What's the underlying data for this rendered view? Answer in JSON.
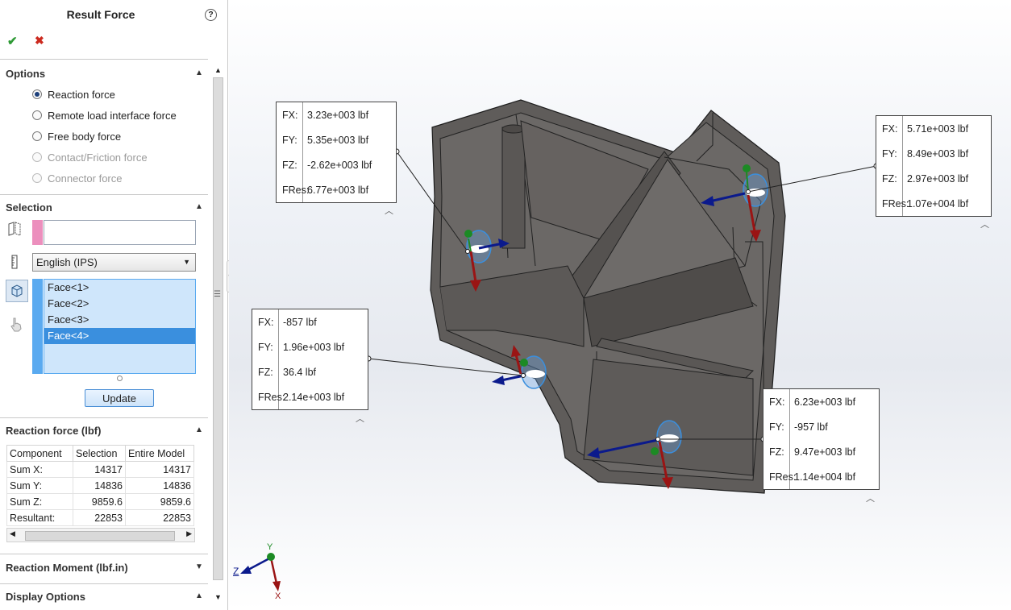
{
  "panel": {
    "title": "Result Force",
    "help": "?",
    "ok": "✔",
    "cancel": "✖",
    "options": {
      "header": "Options",
      "items": [
        {
          "label": "Reaction force",
          "selected": true,
          "enabled": true
        },
        {
          "label": "Remote load interface force",
          "selected": false,
          "enabled": true
        },
        {
          "label": "Free body force",
          "selected": false,
          "enabled": true
        },
        {
          "label": "Contact/Friction force",
          "selected": false,
          "enabled": false
        },
        {
          "label": "Connector force",
          "selected": false,
          "enabled": false
        }
      ]
    },
    "selection": {
      "header": "Selection",
      "input_value": "",
      "units": "English (IPS)",
      "faces": [
        "Face<1>",
        "Face<2>",
        "Face<3>",
        "Face<4>"
      ],
      "selected_face": "Face<4>",
      "update_label": "Update"
    },
    "reaction_force": {
      "header": "Reaction force (lbf)",
      "columns": [
        "Component",
        "Selection",
        "Entire Model"
      ],
      "rows": [
        [
          "Sum X:",
          "14317",
          "14317"
        ],
        [
          "Sum Y:",
          "14836",
          "14836"
        ],
        [
          "Sum Z:",
          "9859.6",
          "9859.6"
        ],
        [
          "Resultant:",
          "22853",
          "22853"
        ]
      ]
    },
    "reaction_moment": {
      "header": "Reaction Moment (lbf.in)"
    },
    "display_options": {
      "header": "Display Options"
    }
  },
  "viewport": {
    "callouts": [
      {
        "id": "c1",
        "rows": [
          [
            "FX:",
            "3.23e+003 lbf"
          ],
          [
            "FY:",
            "5.35e+003 lbf"
          ],
          [
            "FZ:",
            "-2.62e+003 lbf"
          ],
          [
            "FRes:",
            "6.77e+003 lbf"
          ]
        ]
      },
      {
        "id": "c2",
        "rows": [
          [
            "FX:",
            "5.71e+003 lbf"
          ],
          [
            "FY:",
            "8.49e+003 lbf"
          ],
          [
            "FZ:",
            "2.97e+003 lbf"
          ],
          [
            "FRes:",
            "1.07e+004 lbf"
          ]
        ]
      },
      {
        "id": "c3",
        "rows": [
          [
            "FX:",
            "-857 lbf"
          ],
          [
            "FY:",
            "1.96e+003 lbf"
          ],
          [
            "FZ:",
            "36.4 lbf"
          ],
          [
            "FRes:",
            "2.14e+003 lbf"
          ]
        ]
      },
      {
        "id": "c4",
        "rows": [
          [
            "FX:",
            "6.23e+003 lbf"
          ],
          [
            "FY:",
            "-957 lbf"
          ],
          [
            "FZ:",
            "9.47e+003 lbf"
          ],
          [
            "FRes:",
            "1.14e+004 lbf"
          ]
        ]
      }
    ],
    "triad": {
      "y": "Y",
      "z": "Z",
      "x": "X"
    }
  },
  "colors": {
    "part": "#636060",
    "arrow_x": "#0b1a8c",
    "arrow_y": "#9a1414",
    "arrow_z": "#1c8a24",
    "selection": "#3a8fde"
  }
}
